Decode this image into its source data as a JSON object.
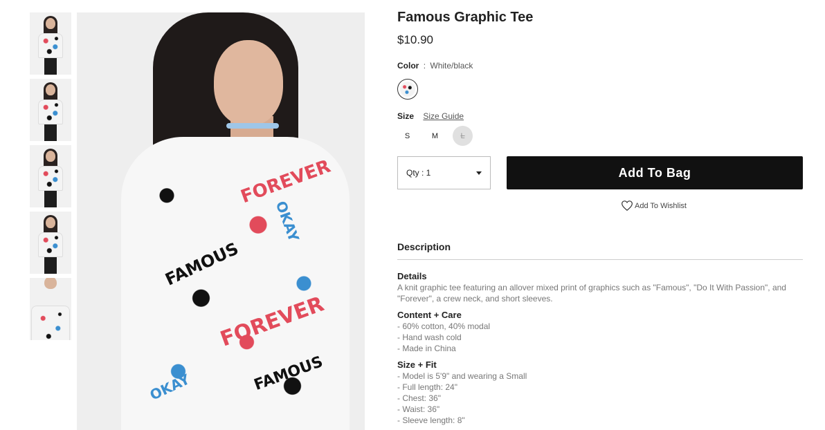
{
  "product": {
    "title": "Famous Graphic Tee",
    "price": "$10.90"
  },
  "color": {
    "label": "Color",
    "separator": ":",
    "value": "White/black"
  },
  "size": {
    "label": "Size",
    "guide_link": "Size Guide",
    "options": [
      "S",
      "M",
      "L"
    ]
  },
  "purchase": {
    "qty_label": "Qty : 1",
    "add_to_bag": "Add To Bag",
    "wishlist": "Add To Wishlist"
  },
  "description": {
    "heading": "Description",
    "details_title": "Details",
    "details_text": "A knit graphic tee featuring an allover mixed print of graphics such as \"Famous\", \"Do It With Passion\", and \"Forever\", a crew neck, and short sleeves.",
    "content_title": "Content + Care",
    "content_lines": [
      "- 60% cotton, 40% modal",
      "- Hand wash cold",
      "- Made in China"
    ],
    "fit_title": "Size + Fit",
    "fit_lines": [
      "- Model is 5'9\" and wearing a Small",
      "- Full length: 24\"",
      "- Chest: 36\"",
      "- Waist: 36\"",
      "- Sleeve length: 8\""
    ]
  },
  "print_words": [
    "FOREVER",
    "OKAY",
    "FAMOUS",
    "FOREVER",
    "FAMOUS",
    "OKAY"
  ],
  "colors": {
    "button": "#111111",
    "print_red": "#e24b5b",
    "print_blue": "#3b8fd0"
  }
}
